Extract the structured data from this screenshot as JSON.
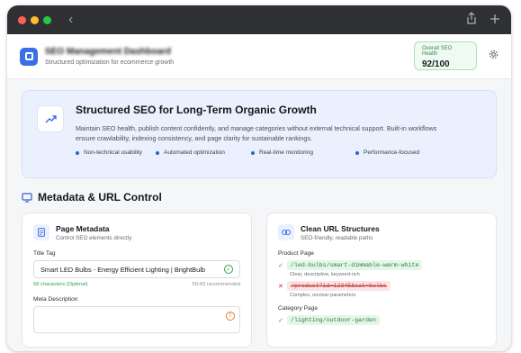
{
  "window": {
    "icons": [
      "back-chevron-icon",
      "share-icon",
      "plus-icon"
    ],
    "traffic_colors": [
      "#ff5f57",
      "#febc2e",
      "#28c840"
    ]
  },
  "header": {
    "title": "SEO Management Dashboard",
    "subtitle": "Structured optimization for ecommerce growth",
    "health_label": "Overall SEO Health",
    "health_value": "92/100"
  },
  "hero": {
    "title": "Structured SEO for Long-Term Organic Growth",
    "description": "Maintain SEO health, publish content confidently, and manage categories without external technical support. Built-in workflows ensure crawlability, indexing consistency, and page clarity for sustainable rankings.",
    "features": [
      "Non-technical usability",
      "Automated optimization",
      "Real-time monitoring",
      "Performance-focused"
    ]
  },
  "section": {
    "title": "Metadata & URL Control"
  },
  "page_metadata": {
    "title": "Page Metadata",
    "subtitle": "Control SEO elements directly",
    "title_tag_label": "Title Tag",
    "title_tag_value": "Smart LED Bulbs - Energy Efficient Lighting | BrightBulb",
    "char_count": "56 characters (Optimal)",
    "recommended": "50-60 recommended",
    "meta_desc_label": "Meta Description"
  },
  "clean_urls": {
    "title": "Clean URL Structures",
    "subtitle": "SEO-friendly, readable paths",
    "product_label": "Product Page",
    "good_url": "/led-bulbs/smart-dimmable-warm-white",
    "good_note": "Clear, descriptive, keyword-rich",
    "bad_url": "/product?id=12345&cat=bulbs",
    "bad_note": "Complex, unclear parameters",
    "category_label": "Category Page",
    "category_url": "/lighting/outdoor-garden"
  },
  "colors": {
    "accent": "#3b6fe6",
    "success": "#2ea24b",
    "danger": "#c43434",
    "warning": "#e77a1c"
  }
}
